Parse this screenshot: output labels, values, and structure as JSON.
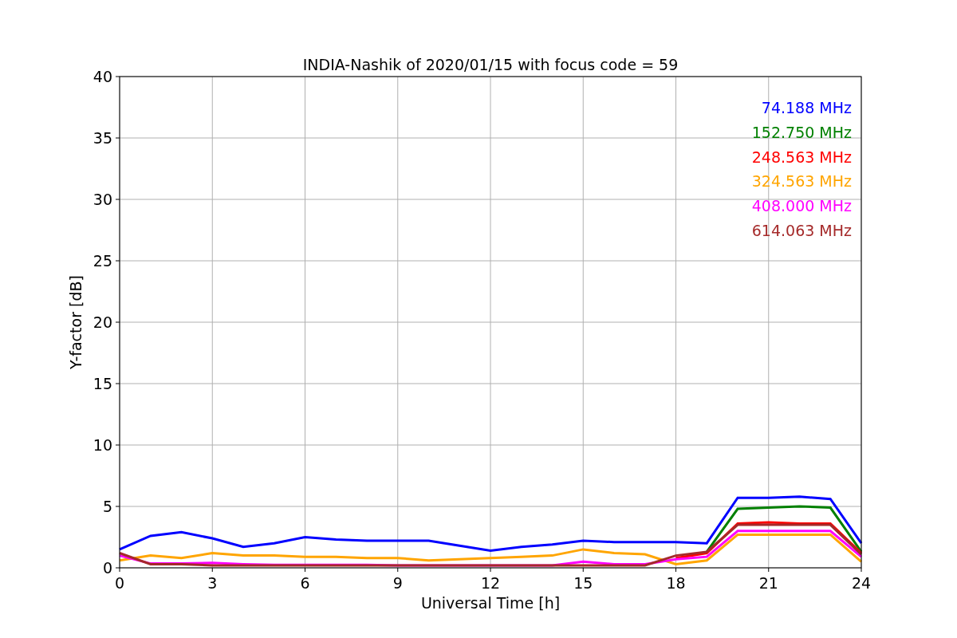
{
  "chart_data": {
    "type": "line",
    "title": "INDIA-Nashik of 2020/01/15 with focus code = 59",
    "xlabel": "Universal Time [h]",
    "ylabel": "Y-factor [dB]",
    "x": [
      0,
      1,
      2,
      3,
      4,
      5,
      6,
      7,
      8,
      9,
      10,
      11,
      12,
      13,
      14,
      15,
      16,
      17,
      18,
      19,
      20,
      21,
      22,
      23,
      24
    ],
    "series": [
      {
        "name": "74.188 MHz",
        "color": "#0000ff",
        "values": [
          1.5,
          2.6,
          2.9,
          2.4,
          1.7,
          2.0,
          2.5,
          2.3,
          2.2,
          2.2,
          2.2,
          1.8,
          1.4,
          1.7,
          1.9,
          2.2,
          2.1,
          2.1,
          2.1,
          2.0,
          5.7,
          5.7,
          5.8,
          5.6,
          2.0
        ]
      },
      {
        "name": "152.750 MHz",
        "color": "#008000",
        "values": [
          null,
          null,
          null,
          null,
          null,
          null,
          null,
          null,
          null,
          null,
          null,
          null,
          null,
          null,
          null,
          null,
          null,
          null,
          null,
          1.3,
          4.8,
          4.9,
          5.0,
          4.9,
          1.3
        ]
      },
      {
        "name": "248.563 MHz",
        "color": "#ff0000",
        "values": [
          null,
          null,
          null,
          null,
          null,
          null,
          null,
          null,
          null,
          null,
          null,
          null,
          null,
          null,
          null,
          null,
          null,
          null,
          0.8,
          1.2,
          3.6,
          3.7,
          3.6,
          3.6,
          1.2
        ]
      },
      {
        "name": "324.563 MHz",
        "color": "#ffa500",
        "values": [
          0.6,
          1.0,
          0.8,
          1.2,
          1.0,
          1.0,
          0.9,
          0.9,
          0.8,
          0.8,
          0.6,
          0.7,
          0.8,
          0.9,
          1.0,
          1.5,
          1.2,
          1.1,
          0.3,
          0.6,
          2.7,
          2.7,
          2.7,
          2.7,
          0.5
        ]
      },
      {
        "name": "408.000 MHz",
        "color": "#ff00ff",
        "values": [
          1.0,
          0.35,
          0.35,
          0.4,
          0.3,
          0.25,
          0.25,
          0.25,
          0.25,
          0.2,
          0.2,
          0.2,
          0.2,
          0.2,
          0.2,
          0.5,
          0.3,
          0.3,
          0.7,
          0.9,
          3.0,
          3.0,
          3.0,
          3.0,
          0.9
        ]
      },
      {
        "name": "614.063 MHz",
        "color": "#a52a2a",
        "values": [
          1.2,
          0.3,
          0.3,
          0.2,
          0.2,
          0.2,
          0.2,
          0.2,
          0.2,
          0.2,
          0.2,
          0.2,
          0.2,
          0.2,
          0.2,
          0.2,
          0.2,
          0.2,
          1.0,
          1.3,
          3.5,
          3.5,
          3.5,
          3.5,
          1.1
        ]
      }
    ],
    "grid": true,
    "xlim": [
      0,
      24
    ],
    "ylim": [
      0,
      40
    ],
    "xticks": [
      0,
      3,
      6,
      9,
      12,
      15,
      18,
      21,
      24
    ],
    "yticks": [
      0,
      5,
      10,
      15,
      20,
      25,
      30,
      35,
      40
    ]
  }
}
